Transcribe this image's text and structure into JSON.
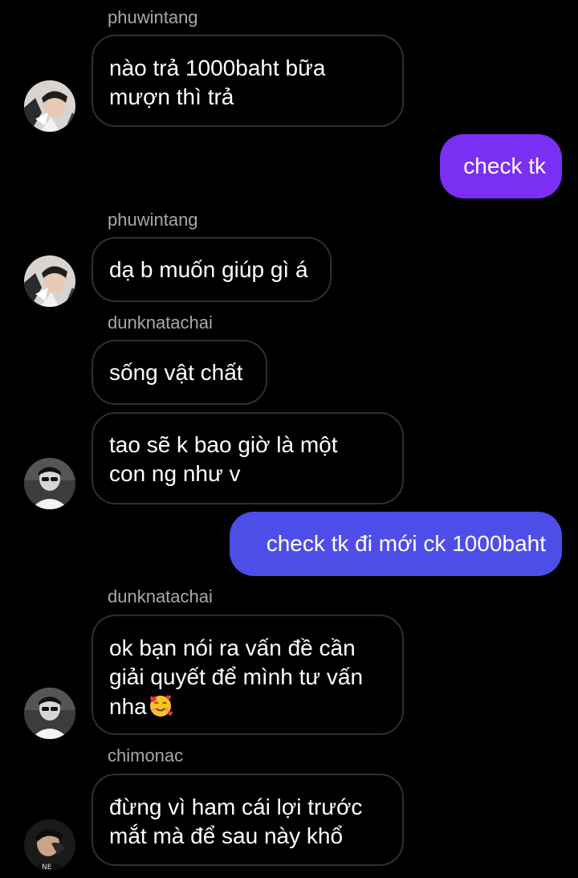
{
  "colors": {
    "background": "#000000",
    "incoming_border": "#2f2f2f",
    "outgoing_purple": "#7b2ff2",
    "outgoing_indigo": "#4d4ee8",
    "sender_name": "#a8a8a8"
  },
  "messages": [
    {
      "sender": "phuwintang",
      "lines": [
        "nào trả 1000baht bữa",
        "mượn thì trả"
      ]
    },
    {
      "lines": [
        "check tk"
      ]
    },
    {
      "sender": "phuwintang",
      "lines": [
        "dạ b muốn giúp gì á"
      ]
    },
    {
      "sender": "dunknatachai",
      "lines": [
        "sống vật chất"
      ]
    },
    {
      "lines": [
        "tao sẽ k bao giờ là một",
        "con ng như v"
      ]
    },
    {
      "lines": [
        "check tk đi mới ck 1000baht"
      ]
    },
    {
      "sender": "dunknatachai",
      "lines": [
        "ok bạn nói ra vấn đề cần",
        "giải quyết để mình tư vấn",
        "nha"
      ],
      "emoji": "smiling-face-with-hearts"
    },
    {
      "sender": "chimonac",
      "lines": [
        "đừng vì ham cái lợi trước",
        "mắt mà để sau này khổ"
      ]
    }
  ],
  "icons": {
    "avatar_phuwintang": "avatar-photo",
    "avatar_dunknatachai": "avatar-photo",
    "avatar_chimonac": "avatar-photo"
  }
}
